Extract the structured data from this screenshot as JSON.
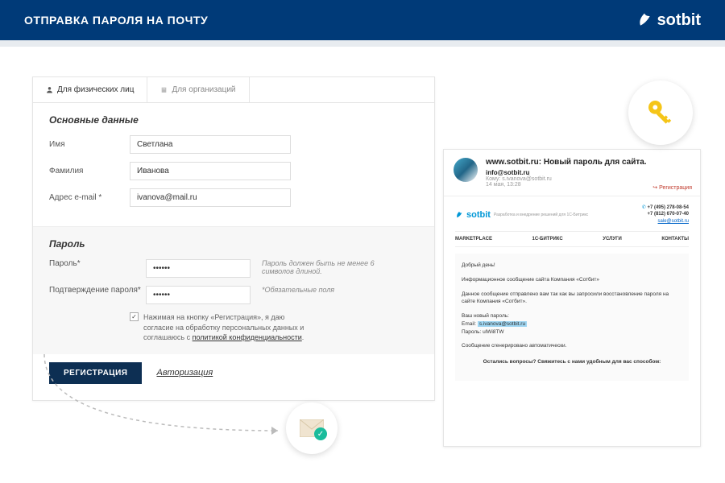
{
  "header": {
    "title": "ОТПРАВКА ПАРОЛЯ НА ПОЧТУ",
    "brand": "sotbit"
  },
  "form": {
    "tabs": {
      "personal": "Для физических лиц",
      "org": "Для организаций"
    },
    "section_basic": "Основные данные",
    "labels": {
      "name": "Имя",
      "surname": "Фамилия",
      "email": "Адрес e-mail *"
    },
    "values": {
      "name": "Светлана",
      "surname": "Иванова",
      "email": "ivanova@mail.ru"
    },
    "section_pw": "Пароль",
    "pw_labels": {
      "password": "Пароль*",
      "confirm": "Подтверждение пароля*"
    },
    "pw_values": {
      "password": "••••••",
      "confirm": "••••••"
    },
    "hints": {
      "length": "Пароль должен быть не менее 6 символов длиной.",
      "required": "*Обязательные поля"
    },
    "consent": {
      "text_before": "Нажимая на кнопку «Регистрация», я даю согласие на обработку персональных данных и соглашаюсь с ",
      "link": "политикой конфиденциальности",
      "text_after": "."
    },
    "buttons": {
      "register": "РЕГИСТРАЦИЯ",
      "auth": "Авторизация"
    }
  },
  "email": {
    "subject": "www.sotbit.ru: Новый пароль для сайта.",
    "from": "info@sotbit.ru",
    "to": "Кому: s.ivanova@sotbit.ru",
    "date": "14 мая, 13:28",
    "action": "Регистрация",
    "brand": {
      "name": "sotbit",
      "slogan": "Разработка и внедрение решений для 1С-Битрикс"
    },
    "contacts": {
      "phone1": "+7 (495) 278-08-54",
      "phone2": "+7 (812) 670-07-40",
      "emailaddr": "sale@sotbit.ru"
    },
    "nav": {
      "n1": "MARKETPLACE",
      "n2": "1С-БИТРИКС",
      "n3": "УСЛУГИ",
      "n4": "КОНТАКТЫ"
    },
    "body": {
      "greeting": "Добрый день!",
      "info": "Информационное сообщение сайта Компания «Сотбит»",
      "msg": "Данное сообщение отправлено вам так как вы запросили восстановление пароля на сайте Компания «Сотбит».",
      "newpw_label": "Ваш новый пароль:",
      "email_label": "Email:",
      "email_value": "s.ivanova@sotbit.ru",
      "pw_label": "Пароль:",
      "pw_value": "ulWi8TW",
      "auto": "Сообщение сгенерировано автоматически.",
      "question": "Остались вопросы? Свяжитесь с нами удобным для вас способом:"
    }
  }
}
